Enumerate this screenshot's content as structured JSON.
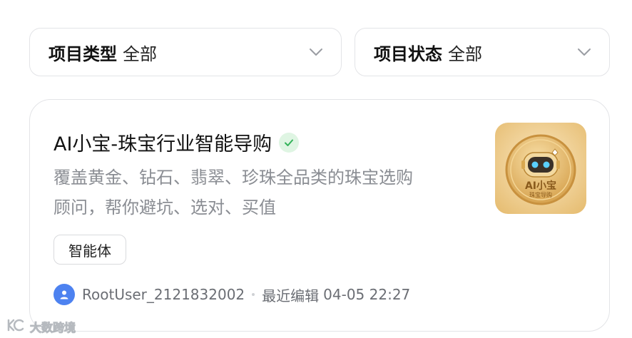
{
  "filters": [
    {
      "label": "项目类型",
      "value": "全部"
    },
    {
      "label": "项目状态",
      "value": "全部"
    }
  ],
  "card": {
    "title": "AI小宝-珠宝行业智能导购",
    "description_line1": "覆盖黄金、钻石、翡翠、珍珠全品类的珠宝选购",
    "description_line2": "顾问，帮你避坑、选对、买值",
    "tag": "智能体",
    "user": "RootUser_2121832002",
    "edit_label": "最近编辑",
    "edit_date": "04-05 22:27",
    "thumbnail": {
      "title": "AI小宝",
      "subtitle": "珠宝导购"
    }
  },
  "watermark": "大数跨境",
  "colors": {
    "accent_green": "#34b35a",
    "avatar_blue": "#4d82f0",
    "thumb_gold": "#e9c27a"
  },
  "icons": {
    "dropdown": "chevron-down-icon",
    "verified": "check-icon",
    "avatar": "user-icon"
  }
}
